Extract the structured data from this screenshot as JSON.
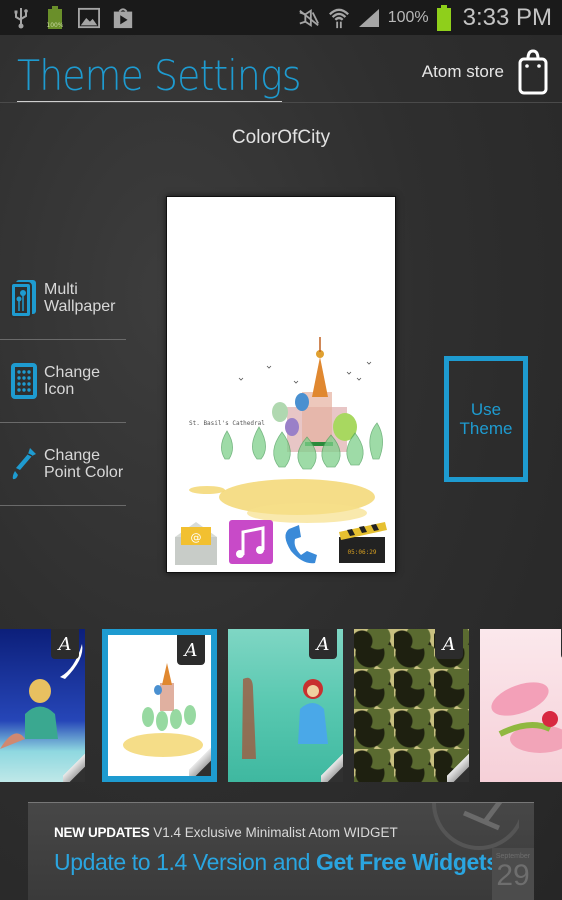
{
  "status_bar": {
    "left_icons": [
      "usb-icon",
      "battery-charging-icon",
      "gallery-icon",
      "play-store-icon"
    ],
    "right_icons": [
      "mute-icon",
      "wifi-icon",
      "signal-icon",
      "battery-icon"
    ],
    "battery_percent": "100%",
    "time": "3:33 PM",
    "battery_color": "#8fcf1b"
  },
  "header": {
    "title": "Theme Settings",
    "store_label": "Atom store",
    "accent_color": "#1e9bd0"
  },
  "theme_name": "ColorOfCity",
  "preview": {
    "caption": "St. Basil's Cathedral",
    "dock_icons": [
      "email-icon",
      "music-icon",
      "phone-icon",
      "video-icon"
    ],
    "clapper_time": "05:06:29"
  },
  "side_menu": [
    {
      "line1": "Multi",
      "line2": "Wallpaper",
      "icon": "multi-wallpaper-icon"
    },
    {
      "line1": "Change",
      "line2": "Icon",
      "icon": "change-icon-icon"
    },
    {
      "line1": "Change",
      "line2": "Point Color",
      "icon": "eyedropper-icon"
    }
  ],
  "use_theme": {
    "line1": "Use",
    "line2": "Theme"
  },
  "carousel": {
    "badge": "A",
    "themes": [
      {
        "name": "little-prince",
        "selected": false
      },
      {
        "name": "color-of-city",
        "selected": true
      },
      {
        "name": "red-riding-hood",
        "selected": false
      },
      {
        "name": "camouflage",
        "selected": false
      },
      {
        "name": "cherry-blossom",
        "selected": false
      }
    ]
  },
  "banner": {
    "tag": "NEW UPDATES",
    "line1_rest": " V1.4  Exclusive Minimalist Atom WIDGET",
    "line2_plain": "Update to 1.4 Version and ",
    "line2_bold": "Get Free Widgets",
    "widget_month": "September",
    "widget_day": "29"
  }
}
